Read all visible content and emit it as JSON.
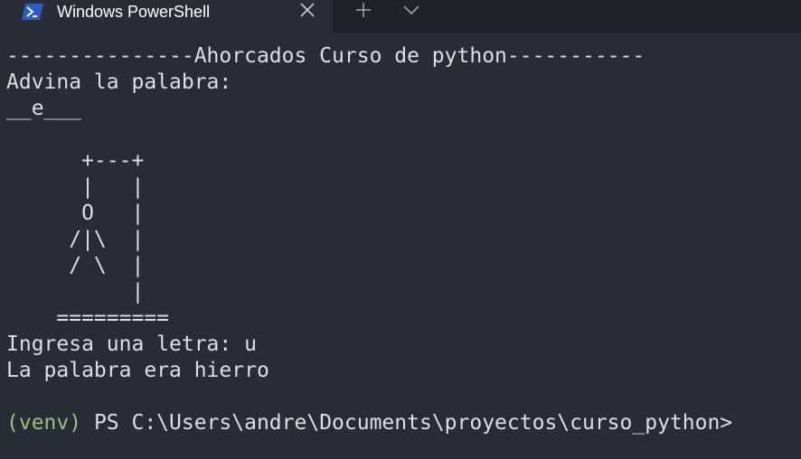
{
  "window": {
    "tab_title": "Windows PowerShell",
    "tab_icon": "powershell-icon",
    "close_icon": "close-icon",
    "new_tab_icon": "plus-icon",
    "dropdown_icon": "chevron-down-icon"
  },
  "colors": {
    "terminal_bg": "#282c34",
    "titlebar_bg": "#1f2228",
    "text": "#dcdfe4",
    "venv": "#98c379",
    "ps_icon": "#2b5cc8"
  },
  "terminal": {
    "lines": [
      "---------------Ahorcados Curso de python-----------",
      "Advina la palabra:",
      "__e___",
      "",
      "      +---+",
      "      |   |",
      "      O   |",
      "     /|\\  |",
      "     / \\  |",
      "          |",
      "    =========",
      "Ingresa una letra: u",
      "La palabra era hierro",
      ""
    ],
    "prompt": {
      "venv": "(venv)",
      "text": " PS C:\\Users\\andre\\Documents\\proyectos\\curso_python>"
    }
  }
}
